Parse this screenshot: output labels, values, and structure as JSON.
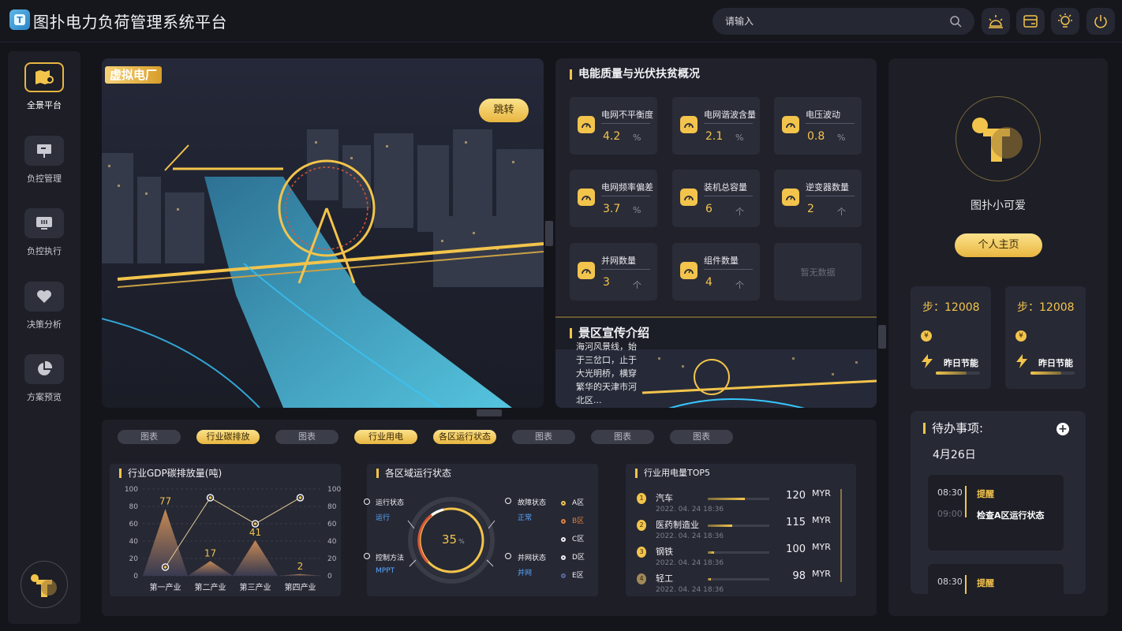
{
  "header": {
    "title": "图扑电力负荷管理系统平台",
    "search_placeholder": "请输入",
    "icons": [
      "search-icon",
      "weather-icon",
      "calendar-icon",
      "sun-icon",
      "power-icon"
    ]
  },
  "sidebar": {
    "items": [
      {
        "label": "全景平台",
        "icon": "map-icon",
        "active": true
      },
      {
        "label": "负控管理",
        "icon": "presentation-icon",
        "active": false
      },
      {
        "label": "负控执行",
        "icon": "monitor-icon",
        "active": false
      },
      {
        "label": "决策分析",
        "icon": "heart-icon",
        "active": false
      },
      {
        "label": "方案预览",
        "icon": "pie-icon",
        "active": false
      }
    ]
  },
  "virtual_plant": {
    "label": "虚拟电厂",
    "jump_button": "跳转"
  },
  "quality": {
    "title": "电能质量与光伏扶贫概况",
    "metrics": [
      {
        "name": "电网不平衡度",
        "value": "4.2",
        "unit": "%"
      },
      {
        "name": "电网谐波含量",
        "value": "2.1",
        "unit": "%"
      },
      {
        "name": "电压波动",
        "value": "0.8",
        "unit": "%"
      },
      {
        "name": "电网频率偏差",
        "value": "3.7",
        "unit": "%"
      },
      {
        "name": "装机总容量",
        "value": "6",
        "unit": "个"
      },
      {
        "name": "逆变器数量",
        "value": "2",
        "unit": "个"
      },
      {
        "name": "并网数量",
        "value": "3",
        "unit": "个"
      },
      {
        "name": "组件数量",
        "value": "4",
        "unit": "个"
      }
    ],
    "empty_text": "暂无数据"
  },
  "scenic": {
    "title": "景区宣传介绍",
    "text": "海河风景线，始于三岔口，止于大光明桥，横穿繁华的天津市河北区..."
  },
  "profile": {
    "username": "图扑小可爱",
    "home_button": "个人主页",
    "step_cards": [
      {
        "steps_label": "步：",
        "steps": "12008",
        "yesterday": "昨日节能",
        "coin": "¥"
      },
      {
        "steps_label": "步：",
        "steps": "12008",
        "yesterday": "昨日节能",
        "coin": "¥"
      }
    ]
  },
  "todo": {
    "title": "待办事项:",
    "add": "+",
    "date": "4月26日",
    "items": [
      {
        "time1": "08:30",
        "time2": "09:00",
        "title": "提醒",
        "desc": "检查A区运行状态"
      },
      {
        "time1": "08:30",
        "time2": "",
        "title": "提醒",
        "desc": ""
      }
    ]
  },
  "tabs": [
    {
      "label": "图表",
      "active": false
    },
    {
      "label": "行业碳排放",
      "active": true
    },
    {
      "label": "图表",
      "active": false
    },
    {
      "label": "行业用电",
      "active": true
    },
    {
      "label": "各区运行状态",
      "active": true
    },
    {
      "label": "图表",
      "active": false
    },
    {
      "label": "图表",
      "active": false
    },
    {
      "label": "图表",
      "active": false
    }
  ],
  "gdp_card": {
    "title": "行业GDP碳排放量(吨)"
  },
  "chart_data": {
    "type": "area",
    "categories": [
      "第一产业",
      "第二产业",
      "第三产业",
      "第四产业"
    ],
    "series": [
      {
        "values": [
          77,
          17,
          41,
          2
        ],
        "render": "area-peaks"
      },
      {
        "values": [
          10,
          90,
          60,
          90
        ],
        "render": "line"
      }
    ],
    "data_labels": [
      "77",
      "17",
      "41",
      "2"
    ],
    "ylim": [
      0,
      100
    ],
    "yticks": [
      0,
      20,
      40,
      60,
      80,
      100
    ],
    "title": "行业GDP碳排放量(吨)"
  },
  "status_card": {
    "title": "各区域运行状态",
    "gauge_value": "35",
    "gauge_unit": "%",
    "items": [
      {
        "label": "运行状态",
        "value": "运行"
      },
      {
        "label": "故障状态",
        "value": "正常"
      },
      {
        "label": "控制方法",
        "value": "MPPT"
      },
      {
        "label": "并网状态",
        "value": "并网"
      }
    ],
    "areas": [
      "A区",
      "B区",
      "C区",
      "D区",
      "E区"
    ]
  },
  "top5": {
    "title": "行业用电量TOP5",
    "rows": [
      {
        "rank": "1",
        "name": "汽车",
        "date": "2022. 04. 24 18:36",
        "value": "120",
        "unit": "MYR",
        "pct": 0.6
      },
      {
        "rank": "2",
        "name": "医药制造业",
        "date": "2022. 04. 24 18:36",
        "value": "115",
        "unit": "MYR",
        "pct": 0.4
      },
      {
        "rank": "3",
        "name": "钢铁",
        "date": "2022. 04. 24 18:36",
        "value": "100",
        "unit": "MYR",
        "pct": 0.1
      },
      {
        "rank": "4",
        "name": "轻工",
        "date": "2022. 04. 24 18:36",
        "value": "98",
        "unit": "MYR",
        "pct": 0.05
      }
    ]
  }
}
